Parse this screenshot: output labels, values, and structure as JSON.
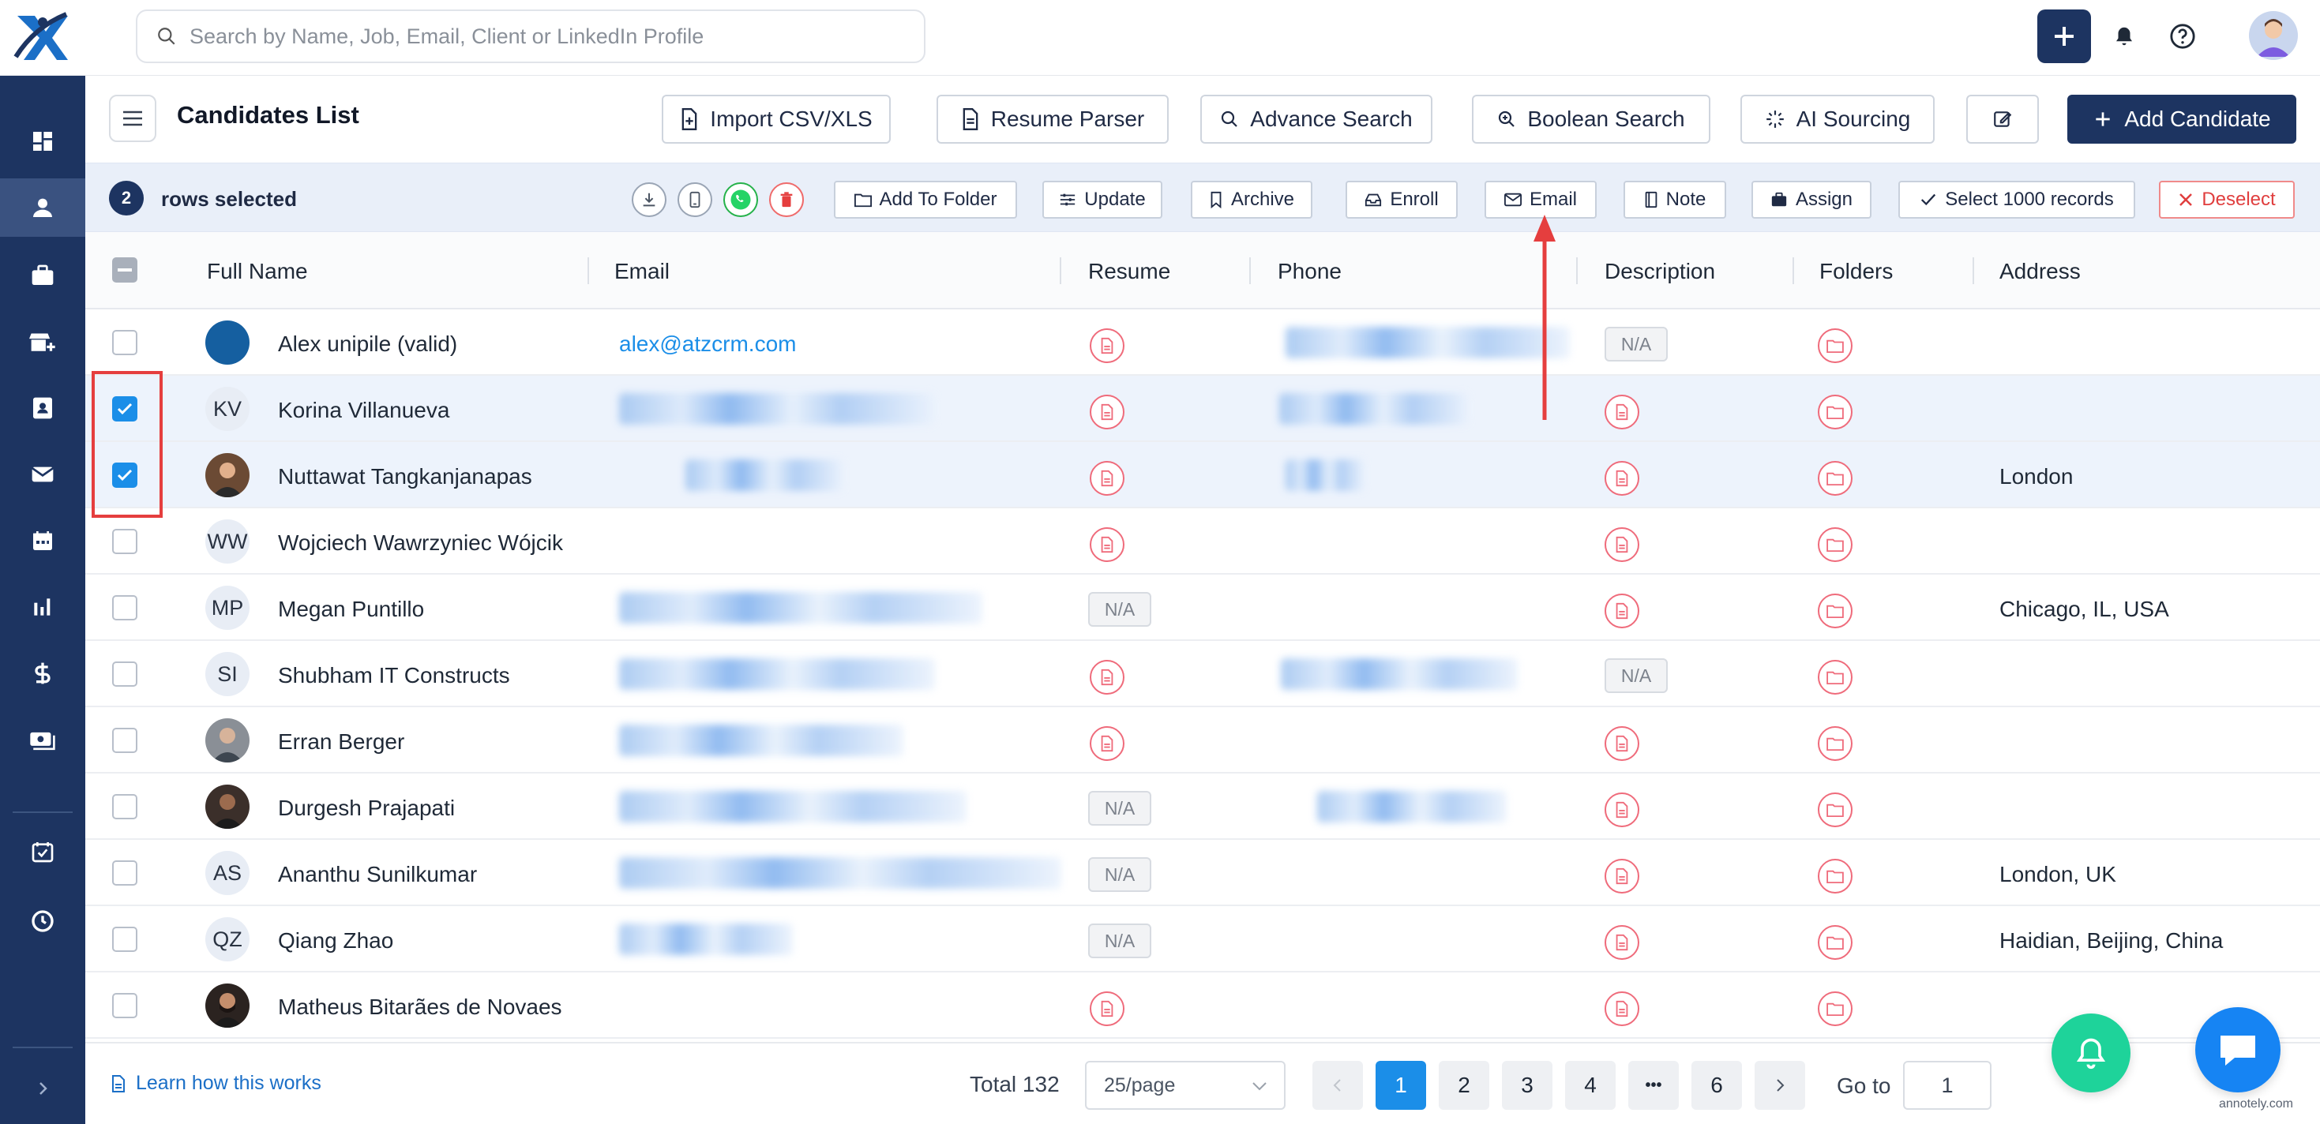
{
  "search": {
    "placeholder": "Search by Name, Job, Email, Client or LinkedIn Profile"
  },
  "header": {
    "title": "Candidates List"
  },
  "toolbar": {
    "import_label": "Import CSV/XLS",
    "parser_label": "Resume Parser",
    "advance_label": "Advance Search",
    "boolean_label": "Boolean Search",
    "ai_label": "AI Sourcing",
    "add_label": "Add Candidate"
  },
  "selection": {
    "count": "2",
    "text": "rows selected",
    "add_folder": "Add To Folder",
    "update": "Update",
    "archive": "Archive",
    "enroll": "Enroll",
    "email": "Email",
    "note": "Note",
    "assign": "Assign",
    "select_all": "Select 1000 records",
    "deselect": "Deselect"
  },
  "columns": {
    "full_name": "Full Name",
    "email": "Email",
    "resume": "Resume",
    "phone": "Phone",
    "description": "Description",
    "folders": "Folders",
    "address": "Address"
  },
  "na_label": "N/A",
  "rows": [
    {
      "name": "Alex unipile (valid)",
      "initials": "",
      "email": "alex@atzcrm.com",
      "address": "",
      "selected": false
    },
    {
      "name": "Korina Villanueva",
      "initials": "KV",
      "email": "",
      "address": "",
      "selected": true
    },
    {
      "name": "Nuttawat Tangkanjanapas",
      "initials": "",
      "email": "",
      "address": "London",
      "selected": true
    },
    {
      "name": "Wojciech Wawrzyniec Wójcik",
      "initials": "WW",
      "email": "",
      "address": "",
      "selected": false
    },
    {
      "name": "Megan Puntillo",
      "initials": "MP",
      "email": "",
      "address": "Chicago, IL, USA",
      "selected": false
    },
    {
      "name": "Shubham IT Constructs",
      "initials": "SI",
      "email": "",
      "address": "",
      "selected": false
    },
    {
      "name": "Erran Berger",
      "initials": "",
      "email": "",
      "address": "",
      "selected": false
    },
    {
      "name": "Durgesh Prajapati",
      "initials": "",
      "email": "",
      "address": "",
      "selected": false
    },
    {
      "name": "Ananthu Sunilkumar",
      "initials": "AS",
      "email": "",
      "address": "London, UK",
      "selected": false
    },
    {
      "name": "Qiang Zhao",
      "initials": "QZ",
      "email": "",
      "address": "Haidian, Beijing, China",
      "selected": false
    },
    {
      "name": "Matheus Bitarães de Novaes",
      "initials": "",
      "email": "",
      "address": "",
      "selected": false
    }
  ],
  "footer": {
    "learn": "Learn how this works",
    "total": "Total 132",
    "per_page": "25/page",
    "pages": [
      "1",
      "2",
      "3",
      "4",
      "•••",
      "6"
    ],
    "goto_label": "Go to",
    "goto_value": "1"
  },
  "watermark": "annotely.com",
  "colors": {
    "brand": "#1d3461",
    "accent": "#1b8ee8",
    "danger": "#e53e3e",
    "resume_icon": "#ef6b7b"
  }
}
